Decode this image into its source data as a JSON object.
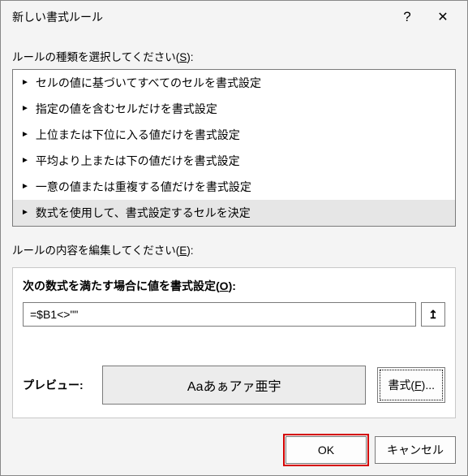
{
  "titlebar": {
    "title": "新しい書式ルール",
    "help": "?",
    "close": "✕"
  },
  "rule_type": {
    "label_pre": "ルールの種類を選択してください(",
    "label_key": "S",
    "label_post": "):",
    "items": [
      "セルの値に基づいてすべてのセルを書式設定",
      "指定の値を含むセルだけを書式設定",
      "上位または下位に入る値だけを書式設定",
      "平均より上または下の値だけを書式設定",
      "一意の値または重複する値だけを書式設定",
      "数式を使用して、書式設定するセルを決定"
    ],
    "selected_index": 5
  },
  "rule_edit": {
    "label_pre": "ルールの内容を編集してください(",
    "label_key": "E",
    "label_post": "):",
    "formula_title_pre": "次の数式を満たす場合に値を書式設定(",
    "formula_title_key": "O",
    "formula_title_post": "):",
    "formula_value": "=$B1<>\"\"",
    "refedit_glyph": "↥",
    "preview_label": "プレビュー:",
    "preview_text": "Aaあぁアァ亜宇",
    "format_btn_pre": "書式(",
    "format_btn_key": "F",
    "format_btn_post": ")..."
  },
  "footer": {
    "ok": "OK",
    "cancel": "キャンセル"
  }
}
